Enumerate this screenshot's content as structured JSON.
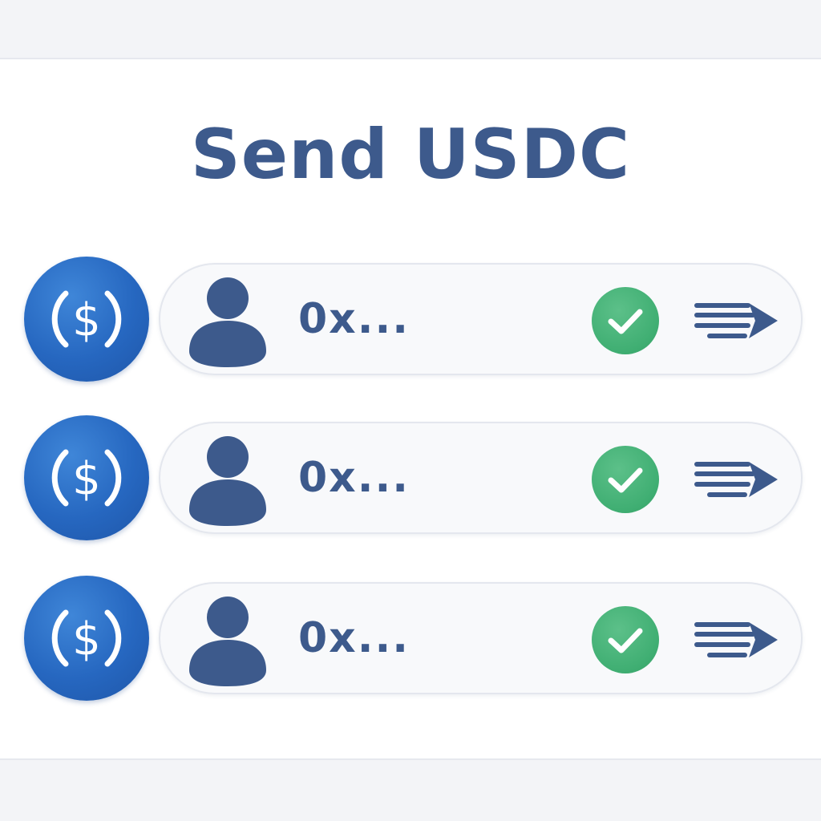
{
  "header": {
    "title": "Send USDC"
  },
  "rows": [
    {
      "coin_icon": "usdc-coin-icon",
      "avatar_icon": "user-avatar-icon",
      "address": "0x...",
      "status_icon": "checkmark-icon",
      "action_icon": "send-arrow-icon"
    },
    {
      "coin_icon": "usdc-coin-icon",
      "avatar_icon": "user-avatar-icon",
      "address": "0x...",
      "status_icon": "checkmark-icon",
      "action_icon": "send-arrow-icon"
    },
    {
      "coin_icon": "usdc-coin-icon",
      "avatar_icon": "user-avatar-icon",
      "address": "0x...",
      "status_icon": "checkmark-icon",
      "action_icon": "send-arrow-icon"
    }
  ],
  "colors": {
    "accent": "#3d5a8c",
    "coin": "#2667c0",
    "success": "#3fae72",
    "background": "#ffffff"
  }
}
